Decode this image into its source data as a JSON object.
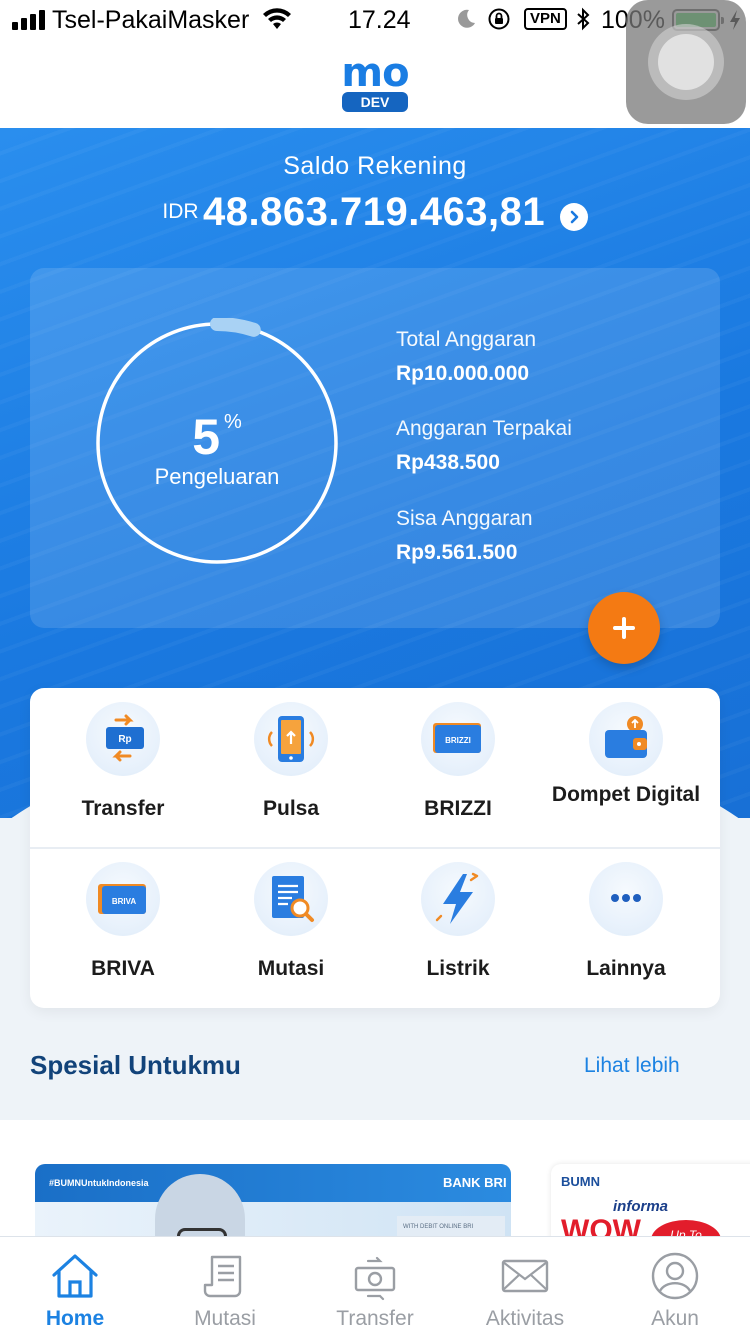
{
  "status_bar": {
    "carrier": "Tsel-PakaiMasker",
    "time": "17.24",
    "vpn": "VPN",
    "battery": "100%"
  },
  "header": {
    "logo_text": "mo",
    "logo_badge": "DEV"
  },
  "balance": {
    "label": "Saldo Rekening",
    "currency": "IDR",
    "amount": "48.863.719.463,81"
  },
  "budget": {
    "percent_value": "5",
    "percent_sign": "%",
    "percent_fraction": 0.05,
    "percent_label": "Pengeluaran",
    "total_label": "Total Anggaran",
    "total_value": "Rp10.000.000",
    "used_label": "Anggaran Terpakai",
    "used_value": "Rp438.500",
    "remaining_label": "Sisa Anggaran",
    "remaining_value": "Rp9.561.500",
    "add_icon": "plus-icon"
  },
  "menu": [
    {
      "label": "Transfer",
      "icon": "transfer-icon",
      "icon_text": "Rp"
    },
    {
      "label": "Pulsa",
      "icon": "phone-icon"
    },
    {
      "label": "BRIZZI",
      "icon": "brizzi-card-icon",
      "icon_text": "BRIZZI"
    },
    {
      "label": "Dompet Digital",
      "icon": "wallet-icon"
    },
    {
      "label": "BRIVA",
      "icon": "briva-card-icon",
      "icon_text": "BRIVA"
    },
    {
      "label": "Mutasi",
      "icon": "document-search-icon"
    },
    {
      "label": "Listrik",
      "icon": "lightning-icon"
    },
    {
      "label": "Lainnya",
      "icon": "more-icon"
    }
  ],
  "special": {
    "title": "Spesial Untukmu",
    "see_more": "Lihat lebih",
    "promos": [
      {
        "tag": "#BUMNUntukIndonesia",
        "brand": "BANK BRI",
        "card_text": "WITH DEBIT ONLINE BRI"
      },
      {
        "brand": "BUMN",
        "partner": "informa",
        "headline": "WOW",
        "badge": "Up To"
      }
    ]
  },
  "tabbar": [
    {
      "label": "Home",
      "icon": "home-icon",
      "active": true
    },
    {
      "label": "Mutasi",
      "icon": "receipt-icon",
      "active": false
    },
    {
      "label": "Transfer",
      "icon": "transfer-money-icon",
      "active": false
    },
    {
      "label": "Aktivitas",
      "icon": "mail-icon",
      "active": false
    },
    {
      "label": "Akun",
      "icon": "user-icon",
      "active": false
    }
  ],
  "colors": {
    "primary_blue": "#1a79e0",
    "accent_orange": "#f47a13",
    "title_navy": "#12437a",
    "link_blue": "#1c82e2"
  }
}
